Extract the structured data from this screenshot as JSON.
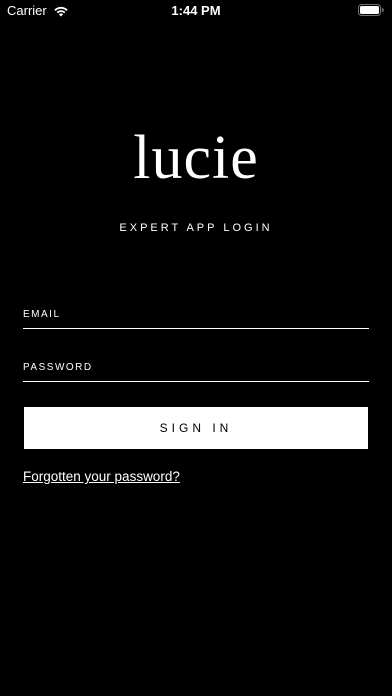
{
  "status_bar": {
    "carrier": "Carrier",
    "time": "1:44 PM",
    "wifi_icon": "wifi-icon",
    "battery_icon": "battery-icon"
  },
  "logo": {
    "text": "lucie"
  },
  "subtitle": "EXPERT APP LOGIN",
  "form": {
    "email_placeholder": "EMAIL",
    "email_value": "",
    "password_placeholder": "PASSWORD",
    "password_value": "",
    "sign_in_label": "SIGN IN",
    "forgot_password_label": "Forgotten your password?"
  },
  "colors": {
    "background": "#000000",
    "foreground": "#ffffff",
    "button_background": "#ffffff",
    "button_text": "#000000"
  }
}
